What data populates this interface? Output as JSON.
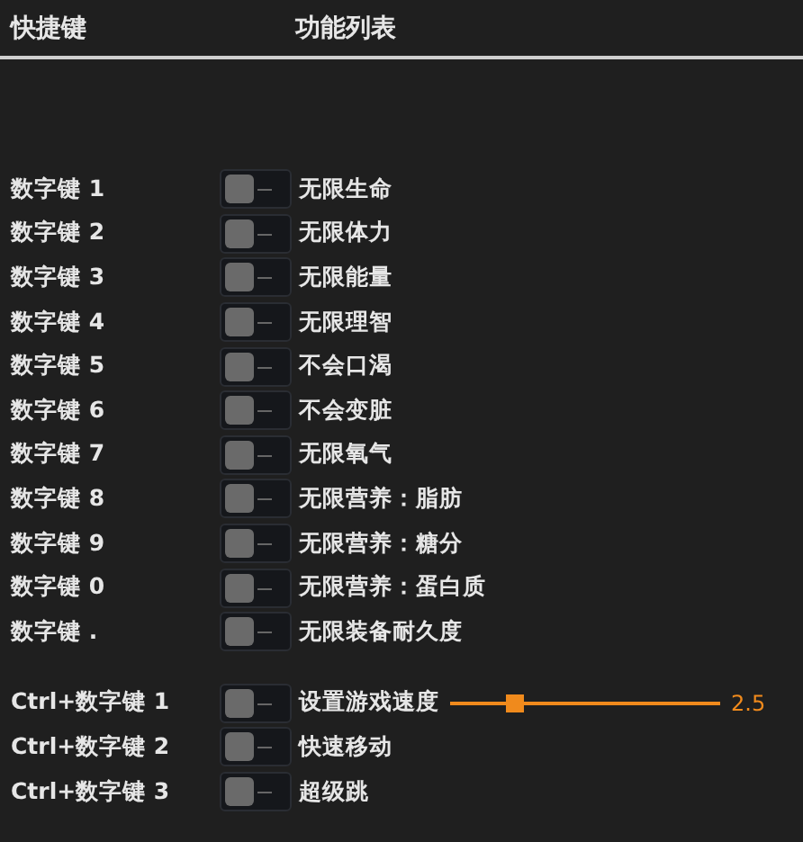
{
  "header": {
    "hotkey_column": "快捷键",
    "function_column": "功能列表"
  },
  "groups": [
    {
      "rows": [
        {
          "hotkey": "数字键 1",
          "on": false,
          "label": "无限生命"
        },
        {
          "hotkey": "数字键 2",
          "on": false,
          "label": "无限体力"
        },
        {
          "hotkey": "数字键 3",
          "on": false,
          "label": "无限能量"
        },
        {
          "hotkey": "数字键 4",
          "on": false,
          "label": "无限理智"
        },
        {
          "hotkey": "数字键 5",
          "on": false,
          "label": "不会口渴"
        },
        {
          "hotkey": "数字键 6",
          "on": false,
          "label": "不会变脏"
        },
        {
          "hotkey": "数字键 7",
          "on": false,
          "label": "无限氧气"
        },
        {
          "hotkey": "数字键 8",
          "on": false,
          "label": "无限营养：脂肪"
        },
        {
          "hotkey": "数字键 9",
          "on": false,
          "label": "无限营养：糖分"
        },
        {
          "hotkey": "数字键 0",
          "on": false,
          "label": "无限营养：蛋白质"
        },
        {
          "hotkey": "数字键 .",
          "on": false,
          "label": "无限装备耐久度"
        }
      ]
    },
    {
      "rows": [
        {
          "hotkey": "Ctrl+数字键 1",
          "on": false,
          "label": "设置游戏速度",
          "slider": {
            "level": 0.24,
            "reading": "2.5"
          }
        },
        {
          "hotkey": "Ctrl+数字键 2",
          "on": false,
          "label": "快速移动"
        },
        {
          "hotkey": "Ctrl+数字键 3",
          "on": false,
          "label": "超级跳"
        }
      ]
    }
  ]
}
